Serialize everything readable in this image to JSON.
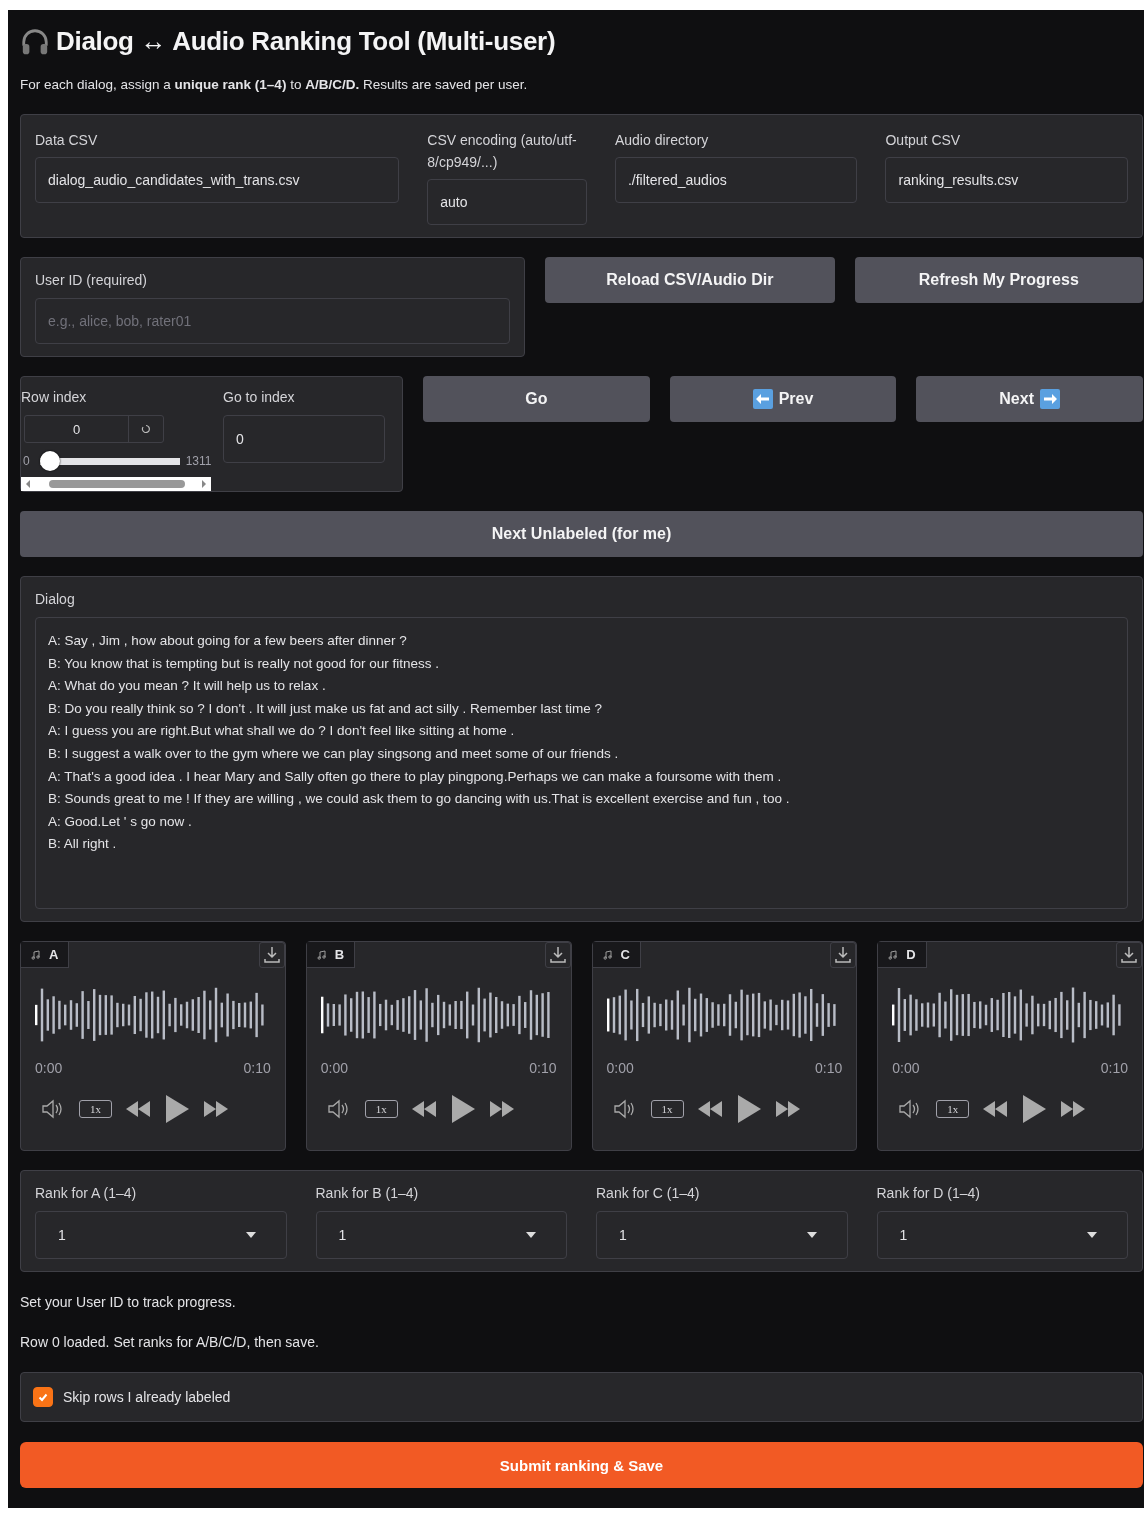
{
  "title": "Dialog ↔ Audio Ranking Tool (Multi-user)",
  "subtitle": "For each dialog, assign a **unique rank (1–4)** to **A/B/C/D.** Results are saved per user.",
  "config_fields": [
    {
      "label": "Data CSV",
      "value": "dialog_audio_candidates_with_trans.csv"
    },
    {
      "label": "CSV encoding (auto/utf-8/cp949/...)",
      "value": "auto"
    },
    {
      "label": "Audio directory",
      "value": "./filtered_audios"
    },
    {
      "label": "Output CSV",
      "value": "ranking_results.csv"
    }
  ],
  "user_id": {
    "label": "User ID (required)",
    "placeholder": "e.g., alice, bob, rater01"
  },
  "top_buttons": [
    "Reload CSV/Audio Dir",
    "Refresh My Progress"
  ],
  "row_index": {
    "label": "Row index",
    "value": "0",
    "min": "0",
    "max": "1311",
    "level": 0
  },
  "go_to_index": {
    "label": "Go to index",
    "value": "0"
  },
  "nav_buttons": [
    {
      "label": "Go",
      "kind": "plain"
    },
    {
      "label": "Prev",
      "kind": "prev"
    },
    {
      "label": "Next",
      "kind": "next"
    }
  ],
  "next_unlabeled_button": "Next Unlabeled (for me)",
  "dialog": {
    "label": "Dialog",
    "lines": [
      "A: Say , Jim , how about going for a few beers after dinner ?",
      "B: You know that is tempting but is really not good for our fitness .",
      "A: What do you mean ? It will help us to relax .",
      "B: Do you really think so ? I don't . It will just make us fat and act silly . Remember last time ?",
      "A: I guess you are right.But what shall we do ? I don't feel like sitting at home .",
      "B: I suggest a walk over to the gym where we can play singsong and meet some of our friends .",
      "A: That's a good idea . I hear Mary and Sally often go there to play pingpong.Perhaps we can make a foursome with them .",
      "B: Sounds great to me ! If they are willing , we could ask them to go dancing with us.That is excellent exercise and fun , too .",
      "A: Good.Let ' s go now .",
      "B: All right ."
    ]
  },
  "audio_players": [
    {
      "label": "A",
      "start": "0:00",
      "end": "0:10",
      "speed": "1x"
    },
    {
      "label": "B",
      "start": "0:00",
      "end": "0:10",
      "speed": "1x"
    },
    {
      "label": "C",
      "start": "0:00",
      "end": "0:10",
      "speed": "1x"
    },
    {
      "label": "D",
      "start": "0:00",
      "end": "0:10",
      "speed": "1x"
    }
  ],
  "ranks": [
    {
      "label": "Rank for A (1–4)",
      "value": "1"
    },
    {
      "label": "Rank for B (1–4)",
      "value": "1"
    },
    {
      "label": "Rank for C (1–4)",
      "value": "1"
    },
    {
      "label": "Rank for D (1–4)",
      "value": "1"
    }
  ],
  "status_messages": [
    "Set your User ID to track progress.",
    "Row 0 loaded. Set ranks for A/B/C/D, then save."
  ],
  "skip_labeled": {
    "label": "Skip rows I already labeled",
    "checked": true
  },
  "submit_button": "Submit ranking & Save"
}
